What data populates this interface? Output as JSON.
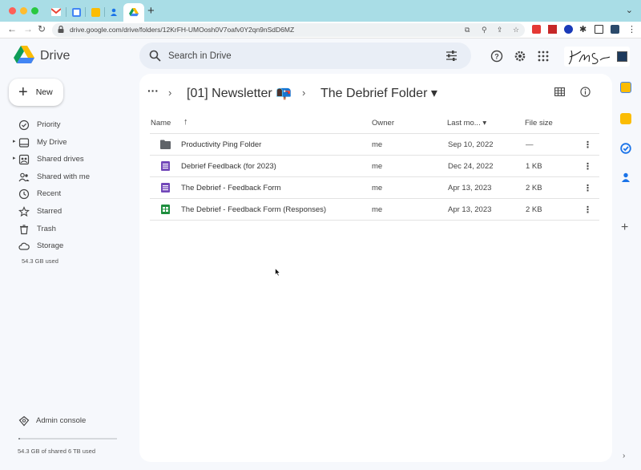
{
  "browser": {
    "tab_add_label": "+",
    "url": "drive.google.com/drive/folders/12KrFH-UMOosh0V7oafv0Y2qn9nSdD6MZ",
    "active_tab_icon": "google-drive-icon"
  },
  "header": {
    "app_name": "Drive",
    "search_placeholder": "Search in Drive"
  },
  "sidebar": {
    "new_label": "New",
    "items": [
      {
        "label": "Priority",
        "icon": "priority-icon"
      },
      {
        "label": "My Drive",
        "icon": "my-drive-icon"
      },
      {
        "label": "Shared drives",
        "icon": "shared-drives-icon"
      },
      {
        "label": "Shared with me",
        "icon": "shared-with-me-icon"
      },
      {
        "label": "Recent",
        "icon": "clock-icon"
      },
      {
        "label": "Starred",
        "icon": "star-icon"
      },
      {
        "label": "Trash",
        "icon": "trash-icon"
      },
      {
        "label": "Storage",
        "icon": "cloud-icon"
      }
    ],
    "storage_used": "54.3 GB used",
    "admin_console": "Admin console",
    "shared_storage": "54.3 GB of shared 6 TB used",
    "shared_storage_fraction": 0.009
  },
  "breadcrumb": {
    "more": "···",
    "parent": "[01] Newsletter 📭",
    "current": "The Debrief Folder ▾"
  },
  "table": {
    "columns": {
      "name": "Name",
      "sort_arrow": "↑",
      "owner": "Owner",
      "modified": "Last mo... ▾",
      "size": "File size"
    },
    "rows": [
      {
        "name": "Productivity Ping Folder",
        "owner": "me",
        "modified": "Sep 10, 2022",
        "size": "—",
        "type": "folder"
      },
      {
        "name": "Debrief Feedback (for 2023)",
        "owner": "me",
        "modified": "Dec 24, 2022",
        "size": "1 KB",
        "type": "form"
      },
      {
        "name": "The Debrief - Feedback Form",
        "owner": "me",
        "modified": "Apr 13, 2023",
        "size": "2 KB",
        "type": "form"
      },
      {
        "name": "The Debrief - Feedback Form (Responses)",
        "owner": "me",
        "modified": "Apr 13, 2023",
        "size": "2 KB",
        "type": "sheet"
      }
    ]
  },
  "colors": {
    "tabbar": "#a9dde6",
    "form_purple": "#7248b9",
    "sheet_green": "#1e8e3e",
    "folder_gray": "#5f6368"
  }
}
